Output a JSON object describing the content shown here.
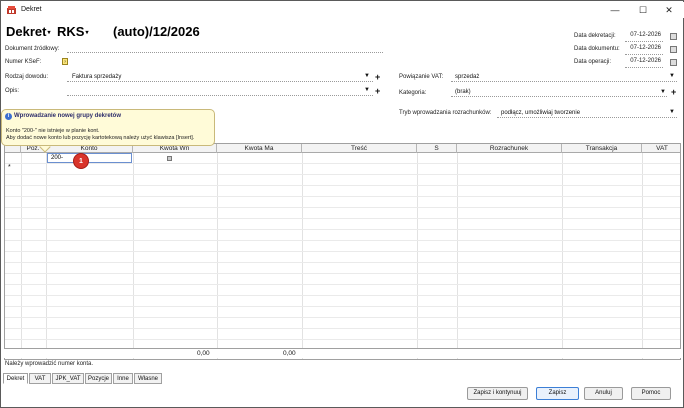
{
  "window": {
    "title": "Dekret",
    "controls": {
      "minimize": "—",
      "maximize": "☐",
      "close": "✕"
    }
  },
  "header": {
    "doc_type": "Dekret",
    "register": "RKS",
    "number": "(auto)/12/2026"
  },
  "fields": {
    "doc_source_label": "Dokument źródłowy:",
    "ksef_label": "Numer KSeF:",
    "ksef_icon": "ksef-icon",
    "proof_type_label": "Rodzaj dowodu:",
    "proof_type_value": "Faktura sprzedaży",
    "desc_label": "Opis:",
    "vat_link_label": "Powiązanie VAT:",
    "vat_link_value": "sprzedaż",
    "category_label": "Kategoria:",
    "category_value": "(brak)",
    "settlement_mode_label": "Tryb wprowadzania rozrachunków:",
    "settlement_mode_value": "podłącz, umożliwiaj tworzenie",
    "booking_date_label": "Data dekretacji:",
    "booking_date_value": "07-12-2026",
    "doc_date_label": "Data dokumentu:",
    "doc_date_value": "07-12-2026",
    "op_date_label": "Data operacji:",
    "op_date_value": "07-12-2026"
  },
  "tooltip": {
    "title": "Wprowadzanie nowej grupy dekretów",
    "line1": "Konto \"200-\" nie istnieje w planie kont.",
    "line2": "Aby dodać nowe konto lub pozycję kartotekową należy użyć klawisza [Insert]."
  },
  "grid": {
    "columns": [
      "Poz.",
      "Konto",
      "Kwota Wn",
      "Kwota Ma",
      "Treść",
      "S",
      "Rozrachunek",
      "Transakcja",
      "VAT"
    ],
    "new_row_marker": "*",
    "edit_value": "200-",
    "step_marker": "1",
    "sum_wn": "0,00",
    "sum_ma": "0,00"
  },
  "status_text": "Należy wprowadzić numer konta.",
  "tabs": [
    "Dekret",
    "VAT",
    "JPK_VAT",
    "Pozycje",
    "Inne",
    "Własne"
  ],
  "buttons": {
    "save_continue": "Zapisz i kontynuuj",
    "save": "Zapisz",
    "cancel": "Anuluj",
    "help": "Pomoc"
  },
  "colors": {
    "tooltip_bg": "#fffbd8",
    "marker": "#d9342b",
    "primary_border": "#3c7fd6"
  }
}
